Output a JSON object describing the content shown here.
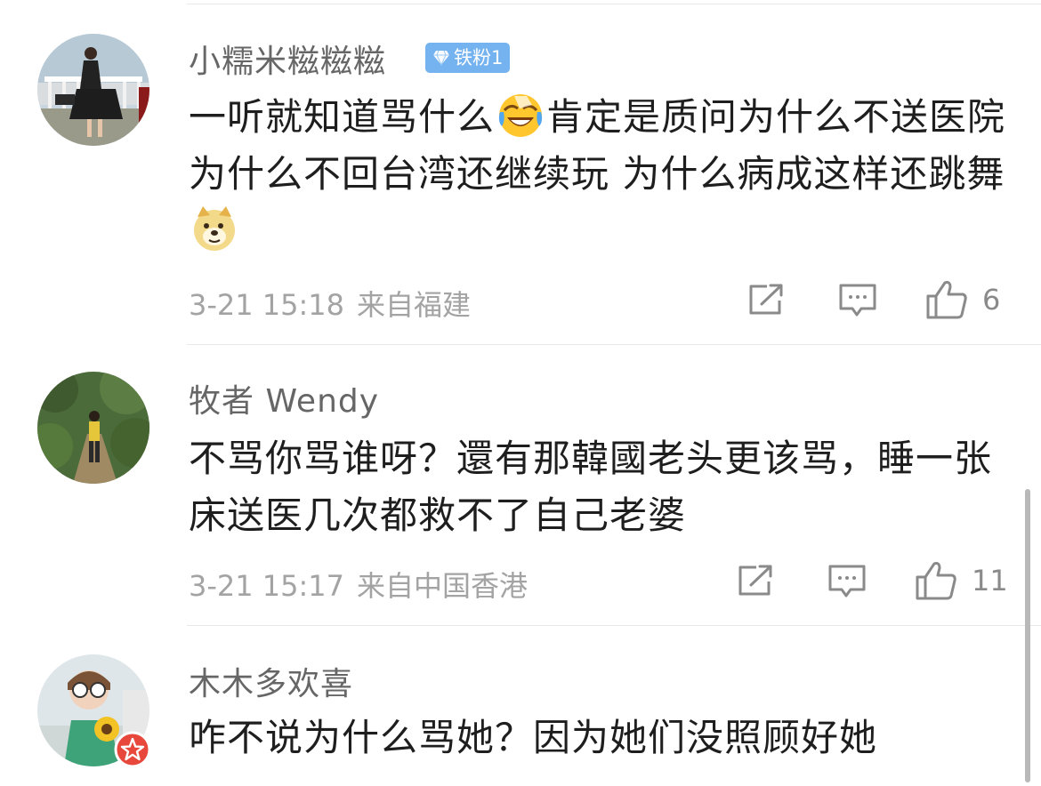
{
  "comments": [
    {
      "username": "小糯米糍糍糍",
      "badge": "铁粉1",
      "text_parts": [
        "一听就知道骂什么",
        "肯定是质问为什么不送医院 为什么不回台湾还继续玩 为什么病成这样还跳舞"
      ],
      "emojis": [
        "laugh-cry-emoji",
        "doge-emoji"
      ],
      "time": "3-21 15:18",
      "location": "来自福建",
      "likes": "6"
    },
    {
      "username": "牧者 Wendy",
      "text": "不骂你骂谁呀？還有那韓國老头更该骂，睡一张床送医几次都救不了自己老婆",
      "time": "3-21 15:17",
      "location": "来自中国香港",
      "likes": "11"
    },
    {
      "username": "木木多欢喜",
      "text": "咋不说为什么骂她？因为她们没照顾好她"
    }
  ],
  "icons": {
    "share": "share-icon",
    "comment": "comment-icon",
    "like": "thumbs-up-icon",
    "vip": "vip-star-icon",
    "badge": "diamond-icon"
  },
  "colors": {
    "badge_bg": "#74b2f0",
    "vip_red": "#e8473b",
    "meta_gray": "#a3a3a3",
    "name_gray": "#666666"
  }
}
